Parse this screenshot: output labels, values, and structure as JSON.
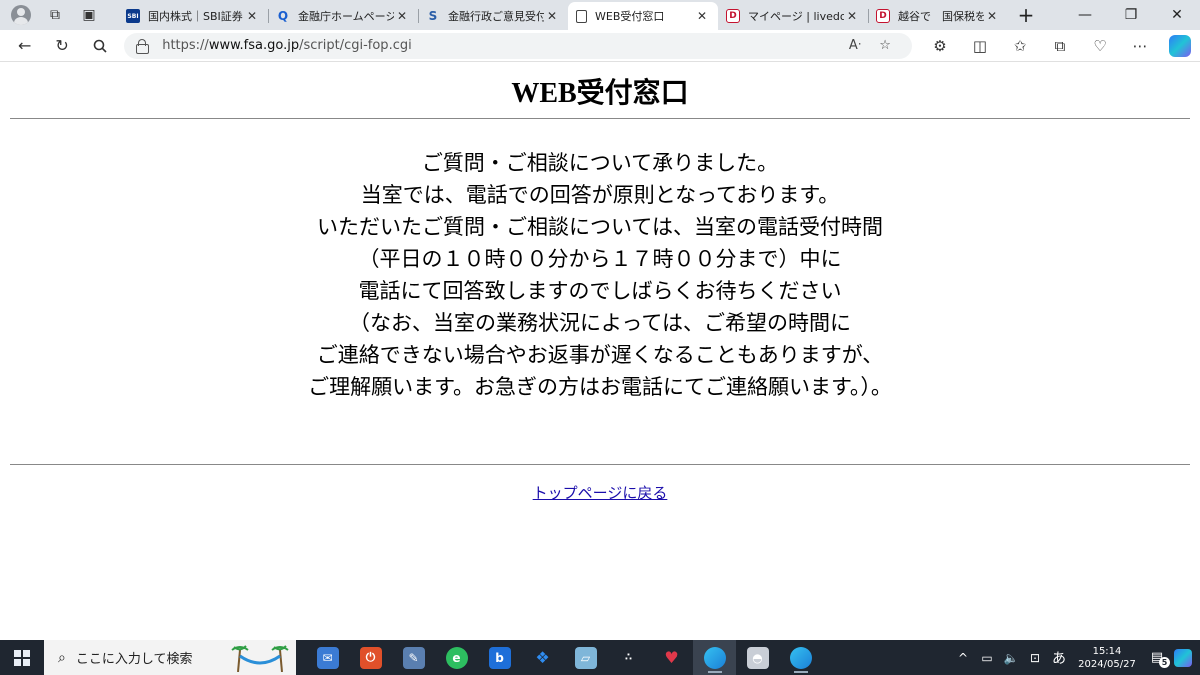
{
  "browser": {
    "tabs": [
      {
        "title": "国内株式｜SBI証券",
        "favicon": "sbi-icon",
        "active": false
      },
      {
        "title": "金融庁ホームページ - S",
        "favicon": "search-icon",
        "active": false
      },
      {
        "title": "金融行政ご意見受付",
        "favicon": "fsa-icon",
        "active": false
      },
      {
        "title": "WEB受付窓口",
        "favicon": "document-icon",
        "active": true
      },
      {
        "title": "マイページ | livedoor B",
        "favicon": "livedoor-icon",
        "active": false
      },
      {
        "title": "越谷で　国保税を",
        "favicon": "livedoor-icon",
        "active": false
      }
    ],
    "favicon_texts": {
      "sbi": "SBI",
      "search": "Q",
      "fsa": "S",
      "livedoor": "D"
    },
    "address": {
      "prefix": "https://",
      "host": "www.fsa.go.jp",
      "path": "/script/cgi-fop.cgi"
    }
  },
  "page": {
    "title": "WEB受付窓口",
    "message_lines": [
      "ご質問・ご相談について承りました。",
      "当室では、電話での回答が原則となっております。",
      "いただいたご質問・ご相談については、当室の電話受付時間",
      "（平日の１０時００分から１７時００分まで）中に",
      "電話にて回答致しますのでしばらくお待ちください",
      "（なお、当室の業務状況によっては、ご希望の時間に",
      "ご連絡できない場合やお返事が遅くなることもありますが、",
      "ご理解願います。お急ぎの方はお電話にてご連絡願います。）。"
    ],
    "back_link": "トップページに戻る"
  },
  "taskbar": {
    "search_placeholder": "ここに入力して検索",
    "ime": "あ",
    "time": "15:14",
    "date": "2024/05/27",
    "notification_count": "5"
  },
  "colors": {
    "tabstrip": "#dfe3e8",
    "link": "#1a0dab",
    "taskbar": "#1f2630"
  }
}
